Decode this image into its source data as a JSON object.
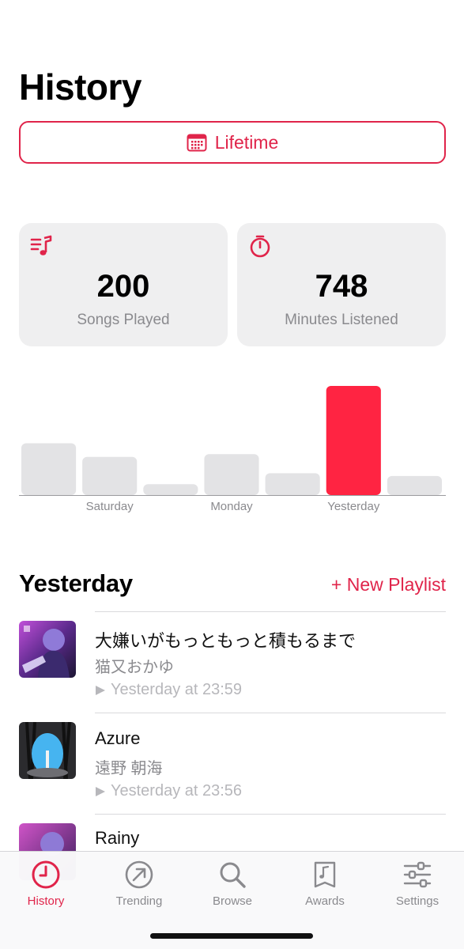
{
  "header": {
    "title": "History"
  },
  "range_selector": {
    "label": "Lifetime",
    "icon": "calendar-icon"
  },
  "stats": [
    {
      "icon": "music-list-icon",
      "value": "200",
      "label": "Songs Played"
    },
    {
      "icon": "stopwatch-icon",
      "value": "748",
      "label": "Minutes Listened"
    }
  ],
  "chart_data": {
    "type": "bar",
    "categories": [
      "",
      "Saturday",
      "",
      "Monday",
      "",
      "Yesterday",
      ""
    ],
    "values": [
      19,
      14,
      4,
      15,
      8,
      40,
      7
    ],
    "highlight_index": 5,
    "ylim": [
      0,
      40
    ],
    "colors": {
      "default": "#e3e3e5",
      "highlight": "#ff2442"
    },
    "grid": false
  },
  "section": {
    "title": "Yesterday",
    "action_label": "New Playlist",
    "action_icon": "plus-icon"
  },
  "songs": [
    {
      "title": "大嫌いがもっともっと積もるまで",
      "artist": "猫又おかゆ",
      "time": "Yesterday at 23:59"
    },
    {
      "title": "Azure",
      "artist": "遠野 朝海",
      "time": "Yesterday at 23:56"
    },
    {
      "title": "Rainy",
      "artist": "",
      "time": ""
    }
  ],
  "tabs": [
    {
      "label": "History",
      "icon": "clock-icon",
      "active": true
    },
    {
      "label": "Trending",
      "icon": "trending-arrow-icon",
      "active": false
    },
    {
      "label": "Browse",
      "icon": "search-icon",
      "active": false
    },
    {
      "label": "Awards",
      "icon": "music-award-icon",
      "active": false
    },
    {
      "label": "Settings",
      "icon": "sliders-icon",
      "active": false
    }
  ],
  "colors": {
    "accent": "#e0244a",
    "card": "#efeff0",
    "secondary_text": "#8a8a8e"
  }
}
